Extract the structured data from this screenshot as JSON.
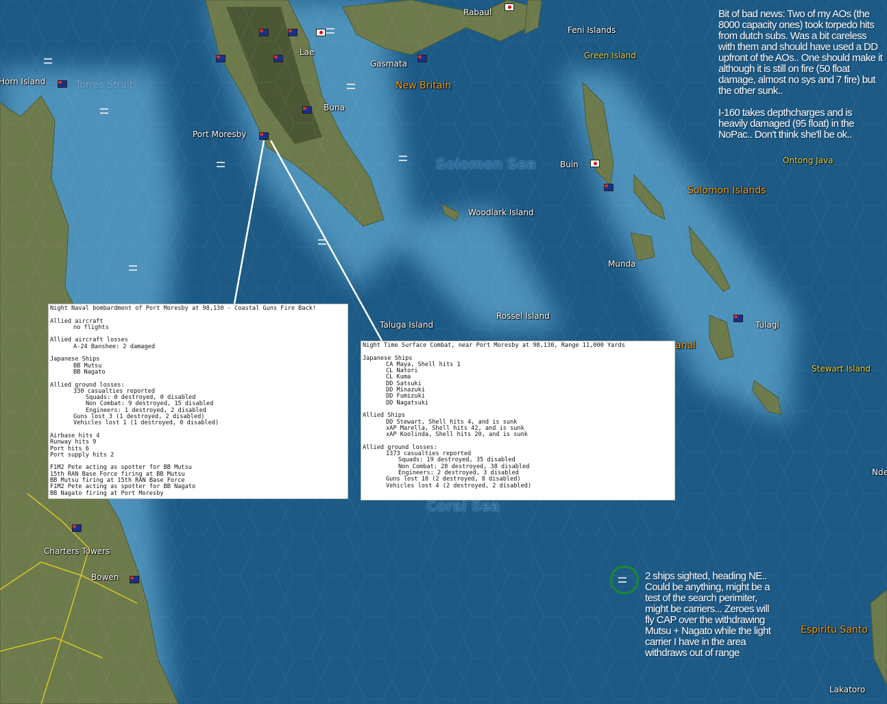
{
  "map_labels": {
    "rabaul": "Rabaul",
    "feni": "Feni Islands",
    "green": "Green Island",
    "lae": "Lae",
    "gasmata": "Gasmata",
    "new_britain": "New Britain",
    "horn": "Horn Island",
    "torres": "Torres Strait",
    "buna": "Buna",
    "port_moresby": "Port Moresby",
    "solomon_sea": "Solomon Sea",
    "buin": "Buin",
    "ontong": "Ontong Java",
    "solomon_islands": "Solomon Islands",
    "woodlark": "Woodlark Island",
    "munda": "Munda",
    "taluga": "Taluga Island",
    "rossel": "Rossel Island",
    "tulagi": "Tulagi",
    "guadalcanal": "anal",
    "stewart": "Stewart Island",
    "ndeni": "Nde",
    "coral_sea": "Coral Sea",
    "charters": "Charters Towers",
    "bowen": "Bowen",
    "espiritu": "Espiritu Santo",
    "lakatoro": "Lakatoro"
  },
  "report_bombardment": {
    "title": "Night Naval bombardment of Port Moresby at 98,130 - Coastal Guns Fire Back!",
    "allied_aircraft_h": "Allied aircraft",
    "allied_aircraft": "no flights",
    "allied_losses_h": "Allied aircraft losses",
    "allied_losses": "A-24 Banshee: 2 damaged",
    "jp_ships_h": "Japanese Ships",
    "jp_ships": [
      "BB Mutsu",
      "BB Nagato"
    ],
    "ground_h": "Allied ground losses:",
    "casualties": "330 casualties reported",
    "details": [
      "Squads: 0 destroyed, 0 disabled",
      "Non Combat: 9 destroyed, 15 disabled",
      "Engineers: 1 destroyed, 2 disabled"
    ],
    "guns": "Guns lost 3 (1 destroyed, 2 disabled)",
    "vehicles": "Vehicles lost 1 (1 destroyed, 0 disabled)",
    "hits": [
      "Airbase hits 4",
      "Runway hits 9",
      "Port hits 6",
      "Port supply hits 2"
    ],
    "events": [
      "F1M2 Pete acting as spotter for BB Mutsu",
      "15th RAN Base Force firing at BB Mutsu",
      "BB Mutsu firing at 15th RAN Base Force",
      "F1M2 Pete acting as spotter for BB Nagato",
      "BB Nagato firing at Port Moresby"
    ]
  },
  "report_surface": {
    "title": "Night Time Surface Combat, near Port Moresby at 98,130, Range 11,000 Yards",
    "jp_ships_h": "Japanese Ships",
    "jp_ships": [
      "CA Maya, Shell hits 1",
      "CL Natori",
      "CL Kuma",
      "DD Satsuki",
      "DD Minazuki",
      "DD Fumizuki",
      "DD Nagatsuki"
    ],
    "allied_ships_h": "Allied Ships",
    "allied_ships": [
      "DD Stewart, Shell hits 4, and is sunk",
      "xAP Marella, Shell hits 42, and is sunk",
      "xAP Koolinda, Shell hits 20, and is sunk"
    ],
    "ground_h": "Allied ground losses:",
    "casualties": "1373 casualties reported",
    "details": [
      "Squads: 19 destroyed, 35 disabled",
      "Non Combat: 28 destroyed, 38 disabled",
      "Engineers: 2 destroyed, 3 disabled"
    ],
    "guns": "Guns lost 10 (2 destroyed, 8 disabled)",
    "vehicles": "Vehicles lost 4 (2 destroyed, 2 disabled)"
  },
  "notes": {
    "top_p1": "Bit of bad news: Two of my AOs (the 8000 capacity ones) took torpedo hits from dutch subs. Was a bit careless with them and should have used a DD upfront of the AOs.. One should make it although it is still on fire (50 float damage, almost no sys and 7 fire) but the other sunk..",
    "top_p2": "I-160 takes depthcharges and is heavily damaged (95 float) in the NoPac.. Don't think she'll be ok..",
    "bottom": "2 ships sighted, heading NE.. Could be anything, might be a test of the search perimiter, might be carriers... Zeroes will fly CAP over the withdrawing Mutsu + Nagato while the light carrier I have in the area withdraws out of range"
  },
  "colors": {
    "sea_deep": "#1d5a86",
    "sea_shallow": "#5aa0c8",
    "land": "#6d7a4c",
    "mountain": "#3f4a2c",
    "sighting_ring": "#1a8a2a"
  }
}
